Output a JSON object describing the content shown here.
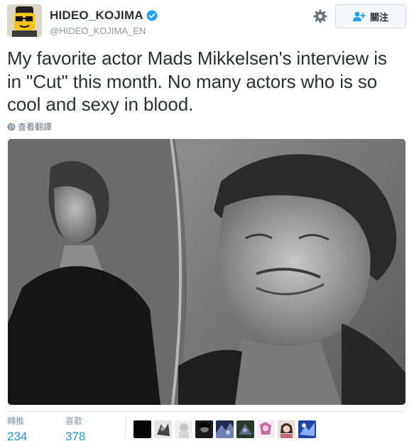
{
  "user": {
    "display_name": "HIDEO_KOJIMA",
    "screen_name": "@HIDEO_KOJIMA_EN",
    "verified_icon": "verified-badge-icon"
  },
  "actions": {
    "settings_icon": "gear-icon",
    "follow_label": "關注"
  },
  "tweet": {
    "text": "My favorite actor Mads Mikkelsen's interview is in \"Cut\" this month. No many actors who is so cool and sexy in blood.",
    "translate_label": "查看翻譯"
  },
  "stats": {
    "retweets_label": "轉推",
    "retweets_count": "234",
    "likes_label": "喜歡",
    "likes_count": "378"
  },
  "colors": {
    "link": "#1b95e0",
    "verified": "#1da1f2",
    "muted": "#8899a6"
  }
}
